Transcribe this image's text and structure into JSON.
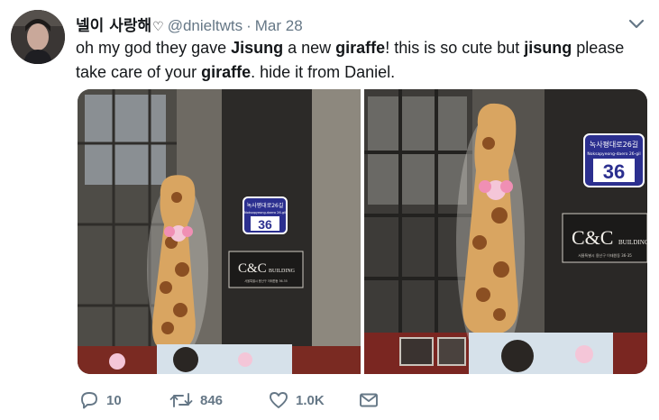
{
  "user": {
    "display_name": "넬이 사랑해",
    "name_emoji": "♡",
    "handle": "@dnieltwts",
    "separator": "·",
    "date": "Mar 28"
  },
  "tweet": {
    "segments": [
      {
        "text": "oh my god they gave ",
        "bold": false
      },
      {
        "text": "Jisung",
        "bold": true
      },
      {
        "text": " a new ",
        "bold": false
      },
      {
        "text": "giraffe",
        "bold": true
      },
      {
        "text": "! this is so cute but ",
        "bold": false
      },
      {
        "text": "jisung",
        "bold": true
      },
      {
        "text": " please take care of your ",
        "bold": false
      },
      {
        "text": "giraffe",
        "bold": true
      },
      {
        "text": ". hide it from Daniel.",
        "bold": false
      }
    ]
  },
  "photos": {
    "left": {
      "address_sign_top": "녹사평대로26길",
      "address_sign_sub": "Noksapyeong-daero 26-gil",
      "address_number": "36",
      "building_logo": "C&C",
      "building_word": "BUILDING",
      "building_small": "서울특별시 용산구 이태원동 36-35"
    },
    "right": {
      "address_sign_top": "녹사평대로26길",
      "address_sign_sub": "Noksapyeong-daero 26-gil",
      "address_number": "36",
      "building_logo": "C&C",
      "building_word": "BUILDING",
      "building_small": "서울특별시 용산구 이태원동 36-35"
    }
  },
  "actions": {
    "reply_count": "10",
    "retweet_count": "846",
    "like_count": "1.0K"
  },
  "icons": {
    "reply": "reply-icon",
    "retweet": "retweet-icon",
    "like": "heart-icon",
    "dm": "envelope-icon",
    "caret": "chevron-down-icon"
  },
  "colors": {
    "text": "#14171a",
    "muted": "#657786",
    "sign_blue": "#2b2f8f",
    "giraffe": "#d9a561"
  }
}
